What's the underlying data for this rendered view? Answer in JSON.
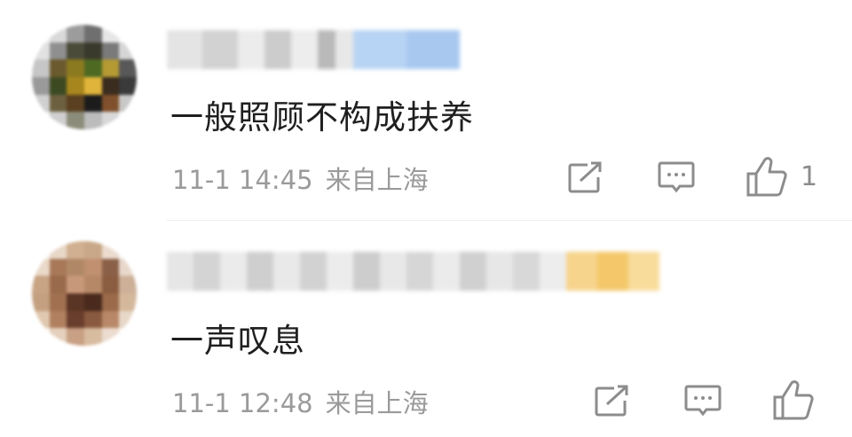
{
  "comments": [
    {
      "text": "一般照顾不构成扶养",
      "time": "11-1 14:45",
      "location": "来自上海",
      "likes": "1"
    },
    {
      "text": "一声叹息",
      "time": "11-1 12:48",
      "location": "来自上海",
      "likes": ""
    }
  ],
  "icons": {
    "share": "share-icon",
    "comment": "comment-icon",
    "like": "thumbs-up-icon"
  },
  "colors": {
    "text": "#1f1f1f",
    "meta": "#9a9a9a",
    "icon": "#8c8c8c"
  }
}
